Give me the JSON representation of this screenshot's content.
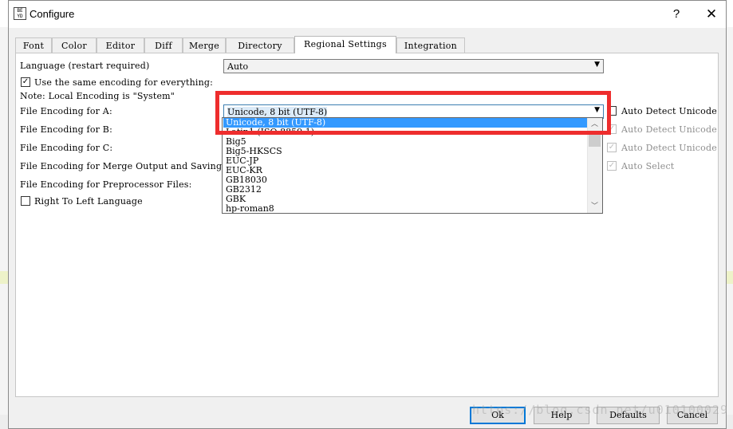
{
  "window": {
    "title": "Configure",
    "app_icon_text": "BEYD diff3"
  },
  "tabs": [
    {
      "label": "Font"
    },
    {
      "label": "Color"
    },
    {
      "label": "Editor"
    },
    {
      "label": "Diff"
    },
    {
      "label": "Merge"
    },
    {
      "label": "Directory"
    },
    {
      "label": "Regional Settings",
      "active": true
    },
    {
      "label": "Integration"
    }
  ],
  "settings": {
    "language_label": "Language (restart required)",
    "language_value": "Auto",
    "same_encoding_label": "Use the same encoding for everything:",
    "same_encoding_checked": true,
    "note": "Note: Local Encoding is \"System\"",
    "enc_a_label": "File Encoding for A:",
    "enc_a_value": "Unicode, 8 bit (UTF-8)",
    "enc_b_label": "File Encoding for B:",
    "enc_c_label": "File Encoding for C:",
    "merge_output_label": "File Encoding for Merge Output and Saving:",
    "preprocessor_label": "File Encoding for Preprocessor Files:",
    "rtl_label": "Right To Left Language",
    "auto_detect_a": "Auto Detect Unicode",
    "auto_detect_b": "Auto Detect Unicode",
    "auto_detect_c": "Auto Detect Unicode",
    "auto_select": "Auto Select"
  },
  "dropdown": {
    "items": [
      "Unicode, 8 bit (UTF-8)",
      "Latin1 (ISO 8859-1)",
      "",
      "Big5",
      "Big5-HKSCS",
      "EUC-JP",
      "EUC-KR",
      "GB18030",
      "GB2312",
      "GBK",
      "hp-roman8"
    ],
    "selected_index": 0
  },
  "buttons": {
    "ok": "Ok",
    "help": "Help",
    "defaults": "Defaults",
    "cancel": "Cancel"
  },
  "title_buttons": {
    "help": "?",
    "close": "✕"
  },
  "watermark": "https://blog.csdn.net/u010100029",
  "colors": {
    "highlight": "#ee2d2d",
    "selection": "#3399ff",
    "focus_border": "#0078d7"
  }
}
